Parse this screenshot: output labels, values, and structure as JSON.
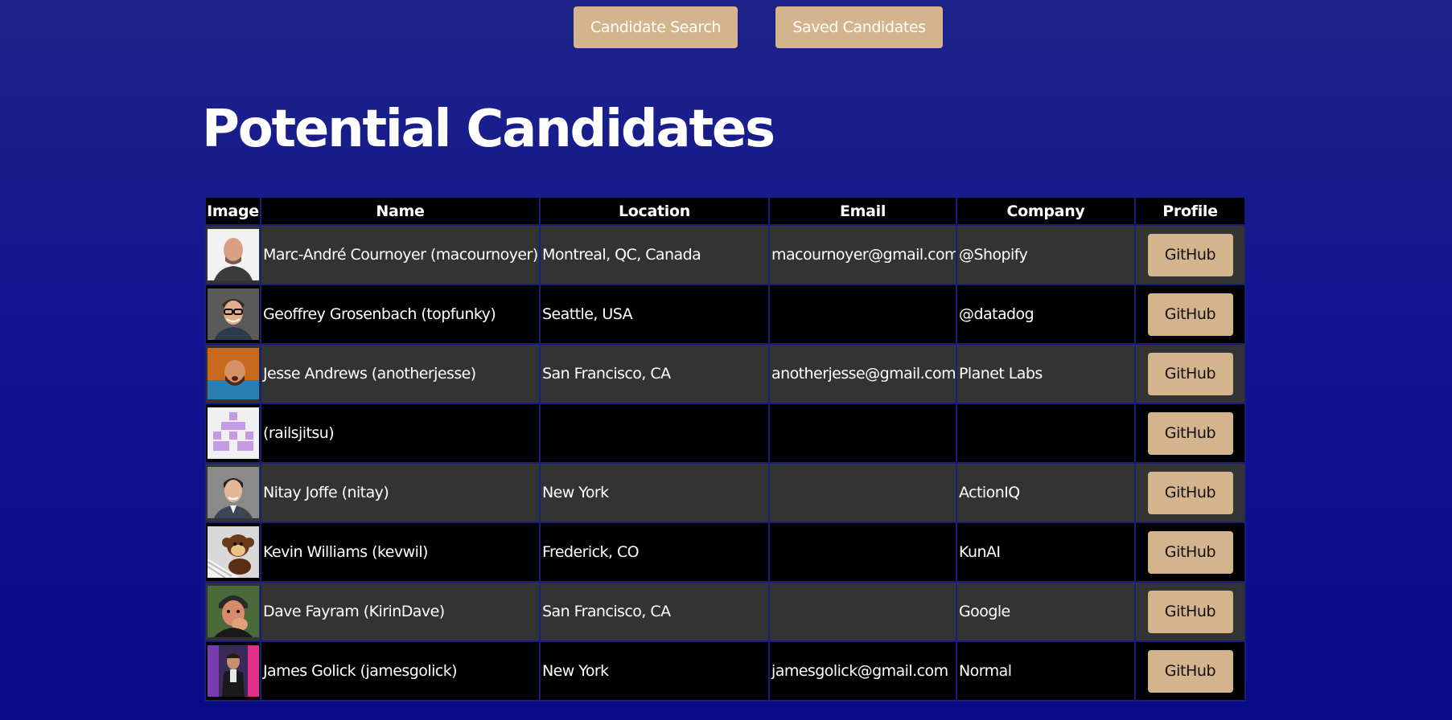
{
  "nav": {
    "candidate_search": "Candidate Search",
    "saved_candidates": "Saved Candidates"
  },
  "page_title": "Potential Candidates",
  "table": {
    "headers": [
      "Image",
      "Name",
      "Location",
      "Email",
      "Company",
      "Profile"
    ],
    "rows": [
      {
        "avatar": "portrait-photo",
        "name": "Marc-André Cournoyer (macournoyer)",
        "location": "Montreal, QC, Canada",
        "email": "macournoyer@gmail.com",
        "company": "@Shopify",
        "profile": "GitHub"
      },
      {
        "avatar": "portrait-photo",
        "name": "Geoffrey Grosenbach (topfunky)",
        "location": "Seattle, USA",
        "email": "",
        "company": "@datadog",
        "profile": "GitHub"
      },
      {
        "avatar": "portrait-photo",
        "name": "Jesse Andrews (anotherjesse)",
        "location": "San Francisco, CA",
        "email": "anotherjesse@gmail.com",
        "company": "Planet Labs",
        "profile": "GitHub"
      },
      {
        "avatar": "identicon",
        "name": "(railsjitsu)",
        "location": "",
        "email": "",
        "company": "",
        "profile": "GitHub"
      },
      {
        "avatar": "portrait-photo",
        "name": "Nitay Joffe (nitay)",
        "location": "New York",
        "email": "",
        "company": "ActionIQ",
        "profile": "GitHub"
      },
      {
        "avatar": "monkey-toy-photo",
        "name": "Kevin Williams (kevwil)",
        "location": "Frederick, CO",
        "email": "",
        "company": "KunAI",
        "profile": "GitHub"
      },
      {
        "avatar": "portrait-photo",
        "name": "Dave Fayram (KirinDave)",
        "location": "San Francisco, CA",
        "email": "",
        "company": "Google",
        "profile": "GitHub"
      },
      {
        "avatar": "portrait-photo",
        "name": "James Golick (jamesgolick)",
        "location": "New York",
        "email": "jamesgolick@gmail.com",
        "company": "Normal",
        "profile": "GitHub"
      }
    ]
  },
  "colors": {
    "background_top": "#1d2388",
    "background_bottom": "#0a0b86",
    "accent_button": "#d4b48c",
    "row_odd": "#333333",
    "row_even": "#000000",
    "header_bg": "#000000",
    "identicon": "#c79ae6"
  }
}
